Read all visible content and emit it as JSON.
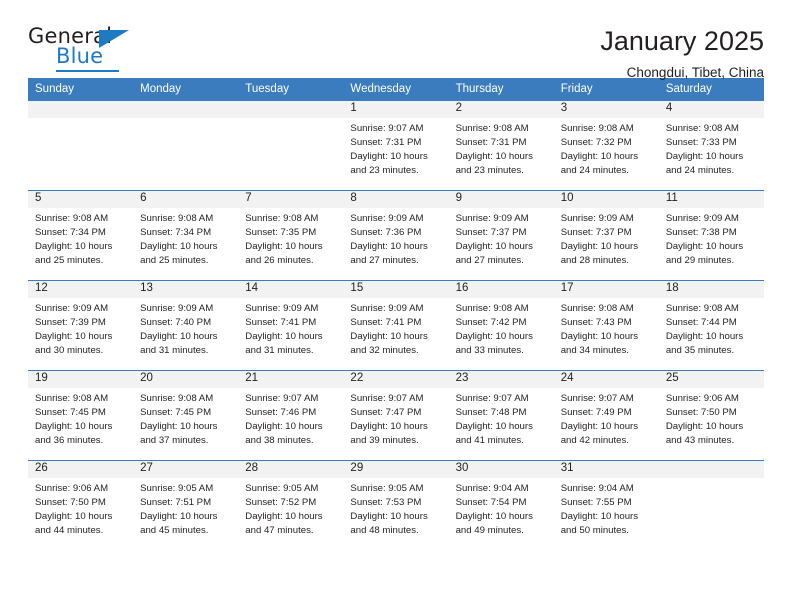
{
  "brand": {
    "name_part1": "General",
    "name_part2": "Blue"
  },
  "header": {
    "title": "January 2025",
    "subtitle": "Chongdui, Tibet, China"
  },
  "colors": {
    "header_blue": "#3a7cbe",
    "brand_blue": "#1f7ac4",
    "day_band_gray": "#f2f2f2",
    "text": "#231f20"
  },
  "weekdays": [
    "Sunday",
    "Monday",
    "Tuesday",
    "Wednesday",
    "Thursday",
    "Friday",
    "Saturday"
  ],
  "weeks": [
    [
      {
        "day": "",
        "sunrise": "",
        "sunset": "",
        "daylight_line1": "",
        "daylight_line2": ""
      },
      {
        "day": "",
        "sunrise": "",
        "sunset": "",
        "daylight_line1": "",
        "daylight_line2": ""
      },
      {
        "day": "",
        "sunrise": "",
        "sunset": "",
        "daylight_line1": "",
        "daylight_line2": ""
      },
      {
        "day": "1",
        "sunrise": "Sunrise: 9:07 AM",
        "sunset": "Sunset: 7:31 PM",
        "daylight_line1": "Daylight: 10 hours",
        "daylight_line2": "and 23 minutes."
      },
      {
        "day": "2",
        "sunrise": "Sunrise: 9:08 AM",
        "sunset": "Sunset: 7:31 PM",
        "daylight_line1": "Daylight: 10 hours",
        "daylight_line2": "and 23 minutes."
      },
      {
        "day": "3",
        "sunrise": "Sunrise: 9:08 AM",
        "sunset": "Sunset: 7:32 PM",
        "daylight_line1": "Daylight: 10 hours",
        "daylight_line2": "and 24 minutes."
      },
      {
        "day": "4",
        "sunrise": "Sunrise: 9:08 AM",
        "sunset": "Sunset: 7:33 PM",
        "daylight_line1": "Daylight: 10 hours",
        "daylight_line2": "and 24 minutes."
      }
    ],
    [
      {
        "day": "5",
        "sunrise": "Sunrise: 9:08 AM",
        "sunset": "Sunset: 7:34 PM",
        "daylight_line1": "Daylight: 10 hours",
        "daylight_line2": "and 25 minutes."
      },
      {
        "day": "6",
        "sunrise": "Sunrise: 9:08 AM",
        "sunset": "Sunset: 7:34 PM",
        "daylight_line1": "Daylight: 10 hours",
        "daylight_line2": "and 25 minutes."
      },
      {
        "day": "7",
        "sunrise": "Sunrise: 9:08 AM",
        "sunset": "Sunset: 7:35 PM",
        "daylight_line1": "Daylight: 10 hours",
        "daylight_line2": "and 26 minutes."
      },
      {
        "day": "8",
        "sunrise": "Sunrise: 9:09 AM",
        "sunset": "Sunset: 7:36 PM",
        "daylight_line1": "Daylight: 10 hours",
        "daylight_line2": "and 27 minutes."
      },
      {
        "day": "9",
        "sunrise": "Sunrise: 9:09 AM",
        "sunset": "Sunset: 7:37 PM",
        "daylight_line1": "Daylight: 10 hours",
        "daylight_line2": "and 27 minutes."
      },
      {
        "day": "10",
        "sunrise": "Sunrise: 9:09 AM",
        "sunset": "Sunset: 7:37 PM",
        "daylight_line1": "Daylight: 10 hours",
        "daylight_line2": "and 28 minutes."
      },
      {
        "day": "11",
        "sunrise": "Sunrise: 9:09 AM",
        "sunset": "Sunset: 7:38 PM",
        "daylight_line1": "Daylight: 10 hours",
        "daylight_line2": "and 29 minutes."
      }
    ],
    [
      {
        "day": "12",
        "sunrise": "Sunrise: 9:09 AM",
        "sunset": "Sunset: 7:39 PM",
        "daylight_line1": "Daylight: 10 hours",
        "daylight_line2": "and 30 minutes."
      },
      {
        "day": "13",
        "sunrise": "Sunrise: 9:09 AM",
        "sunset": "Sunset: 7:40 PM",
        "daylight_line1": "Daylight: 10 hours",
        "daylight_line2": "and 31 minutes."
      },
      {
        "day": "14",
        "sunrise": "Sunrise: 9:09 AM",
        "sunset": "Sunset: 7:41 PM",
        "daylight_line1": "Daylight: 10 hours",
        "daylight_line2": "and 31 minutes."
      },
      {
        "day": "15",
        "sunrise": "Sunrise: 9:09 AM",
        "sunset": "Sunset: 7:41 PM",
        "daylight_line1": "Daylight: 10 hours",
        "daylight_line2": "and 32 minutes."
      },
      {
        "day": "16",
        "sunrise": "Sunrise: 9:08 AM",
        "sunset": "Sunset: 7:42 PM",
        "daylight_line1": "Daylight: 10 hours",
        "daylight_line2": "and 33 minutes."
      },
      {
        "day": "17",
        "sunrise": "Sunrise: 9:08 AM",
        "sunset": "Sunset: 7:43 PM",
        "daylight_line1": "Daylight: 10 hours",
        "daylight_line2": "and 34 minutes."
      },
      {
        "day": "18",
        "sunrise": "Sunrise: 9:08 AM",
        "sunset": "Sunset: 7:44 PM",
        "daylight_line1": "Daylight: 10 hours",
        "daylight_line2": "and 35 minutes."
      }
    ],
    [
      {
        "day": "19",
        "sunrise": "Sunrise: 9:08 AM",
        "sunset": "Sunset: 7:45 PM",
        "daylight_line1": "Daylight: 10 hours",
        "daylight_line2": "and 36 minutes."
      },
      {
        "day": "20",
        "sunrise": "Sunrise: 9:08 AM",
        "sunset": "Sunset: 7:45 PM",
        "daylight_line1": "Daylight: 10 hours",
        "daylight_line2": "and 37 minutes."
      },
      {
        "day": "21",
        "sunrise": "Sunrise: 9:07 AM",
        "sunset": "Sunset: 7:46 PM",
        "daylight_line1": "Daylight: 10 hours",
        "daylight_line2": "and 38 minutes."
      },
      {
        "day": "22",
        "sunrise": "Sunrise: 9:07 AM",
        "sunset": "Sunset: 7:47 PM",
        "daylight_line1": "Daylight: 10 hours",
        "daylight_line2": "and 39 minutes."
      },
      {
        "day": "23",
        "sunrise": "Sunrise: 9:07 AM",
        "sunset": "Sunset: 7:48 PM",
        "daylight_line1": "Daylight: 10 hours",
        "daylight_line2": "and 41 minutes."
      },
      {
        "day": "24",
        "sunrise": "Sunrise: 9:07 AM",
        "sunset": "Sunset: 7:49 PM",
        "daylight_line1": "Daylight: 10 hours",
        "daylight_line2": "and 42 minutes."
      },
      {
        "day": "25",
        "sunrise": "Sunrise: 9:06 AM",
        "sunset": "Sunset: 7:50 PM",
        "daylight_line1": "Daylight: 10 hours",
        "daylight_line2": "and 43 minutes."
      }
    ],
    [
      {
        "day": "26",
        "sunrise": "Sunrise: 9:06 AM",
        "sunset": "Sunset: 7:50 PM",
        "daylight_line1": "Daylight: 10 hours",
        "daylight_line2": "and 44 minutes."
      },
      {
        "day": "27",
        "sunrise": "Sunrise: 9:05 AM",
        "sunset": "Sunset: 7:51 PM",
        "daylight_line1": "Daylight: 10 hours",
        "daylight_line2": "and 45 minutes."
      },
      {
        "day": "28",
        "sunrise": "Sunrise: 9:05 AM",
        "sunset": "Sunset: 7:52 PM",
        "daylight_line1": "Daylight: 10 hours",
        "daylight_line2": "and 47 minutes."
      },
      {
        "day": "29",
        "sunrise": "Sunrise: 9:05 AM",
        "sunset": "Sunset: 7:53 PM",
        "daylight_line1": "Daylight: 10 hours",
        "daylight_line2": "and 48 minutes."
      },
      {
        "day": "30",
        "sunrise": "Sunrise: 9:04 AM",
        "sunset": "Sunset: 7:54 PM",
        "daylight_line1": "Daylight: 10 hours",
        "daylight_line2": "and 49 minutes."
      },
      {
        "day": "31",
        "sunrise": "Sunrise: 9:04 AM",
        "sunset": "Sunset: 7:55 PM",
        "daylight_line1": "Daylight: 10 hours",
        "daylight_line2": "and 50 minutes."
      },
      {
        "day": "",
        "sunrise": "",
        "sunset": "",
        "daylight_line1": "",
        "daylight_line2": ""
      }
    ]
  ]
}
